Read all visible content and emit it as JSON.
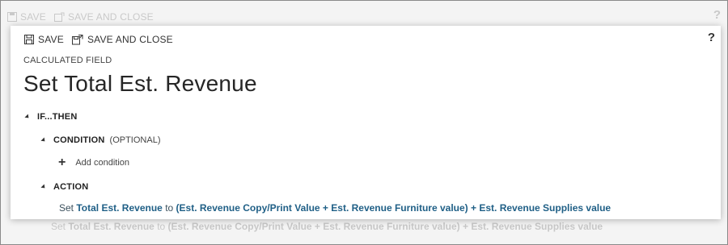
{
  "toolbar": {
    "save_label": "SAVE",
    "save_close_label": "SAVE AND CLOSE",
    "help_label": "?"
  },
  "header": {
    "kicker": "CALCULATED FIELD",
    "title": "Set Total Est. Revenue"
  },
  "sections": {
    "if_then": "IF...THEN",
    "condition": "CONDITION",
    "condition_optional": "(OPTIONAL)",
    "add_condition": "Add condition",
    "action": "ACTION"
  },
  "formula": {
    "set": "Set",
    "target": "Total Est. Revenue",
    "to": "to",
    "group": "(Est. Revenue Copy/Print Value + Est. Revenue Furniture value)",
    "plus": "+",
    "tail": "Est. Revenue Supplies value"
  },
  "colors": {
    "accent": "#1f5f86",
    "text": "#222222",
    "background": "#f4f4f4"
  }
}
